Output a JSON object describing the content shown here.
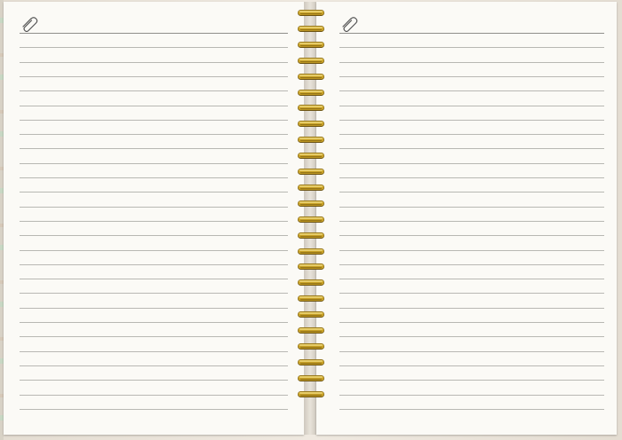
{
  "notebook": {
    "left_page": {
      "icon": "paperclip-icon",
      "line_count": 27
    },
    "right_page": {
      "icon": "paperclip-icon",
      "line_count": 27
    },
    "binding": {
      "type": "spiral",
      "ring_count": 25,
      "ring_color": "#c9a227"
    },
    "colors": {
      "paper": "#fbfaf6",
      "cover": "#e9e4dc",
      "rule_line": "#b8b8b3",
      "ring_gold": "#c9a227"
    }
  }
}
